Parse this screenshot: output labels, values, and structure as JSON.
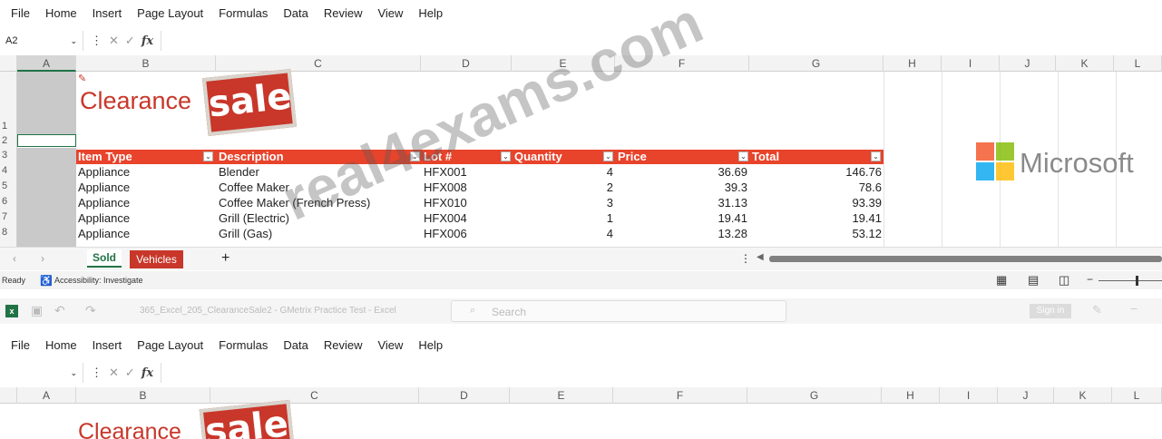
{
  "menu": [
    "File",
    "Home",
    "Insert",
    "Page Layout",
    "Formulas",
    "Data",
    "Review",
    "View",
    "Help"
  ],
  "formula_bar": {
    "name_box": "A2",
    "cancel": "✕",
    "enter": "✓",
    "fx": "fx"
  },
  "columns": [
    "A",
    "B",
    "C",
    "D",
    "E",
    "F",
    "G",
    "H",
    "I",
    "J",
    "K",
    "L"
  ],
  "rows": [
    "1",
    "2",
    "3",
    "4",
    "5",
    "6",
    "7",
    "8"
  ],
  "banner": {
    "title": "Clearance",
    "sale": "sale"
  },
  "table_headers": [
    "Item Type",
    "Description",
    "Lot #",
    "Quantity",
    "Price",
    "Total"
  ],
  "table_rows": [
    [
      "Appliance",
      "Blender",
      "HFX001",
      "4",
      "36.69",
      "146.76"
    ],
    [
      "Appliance",
      "Coffee Maker",
      "HFX008",
      "2",
      "39.3",
      "78.6"
    ],
    [
      "Appliance",
      "Coffee Maker (French Press)",
      "HFX010",
      "3",
      "31.13",
      "93.39"
    ],
    [
      "Appliance",
      "Grill (Electric)",
      "HFX004",
      "1",
      "19.41",
      "19.41"
    ],
    [
      "Appliance",
      "Grill (Gas)",
      "HFX006",
      "4",
      "13.28",
      "53.12"
    ]
  ],
  "sheet_tabs": {
    "active": "Sold",
    "other": "Vehicles",
    "add": "+"
  },
  "status": {
    "ready": "Ready",
    "accessibility": "Accessibility: Investigate"
  },
  "logo": {
    "text": "Microsoft",
    "colors": [
      "#f25022",
      "#7fba00",
      "#00a4ef",
      "#ffb900"
    ]
  },
  "watermark": "real4exams.com",
  "second_window": {
    "title": "365_Excel_205_ClearanceSale2 - GMetrix Practice Test - Excel",
    "search": "Search",
    "sign_in": "Sign in"
  },
  "colors": {
    "header_red": "#e8432b",
    "sale_red": "#c8372a",
    "excel_green": "#217346"
  }
}
